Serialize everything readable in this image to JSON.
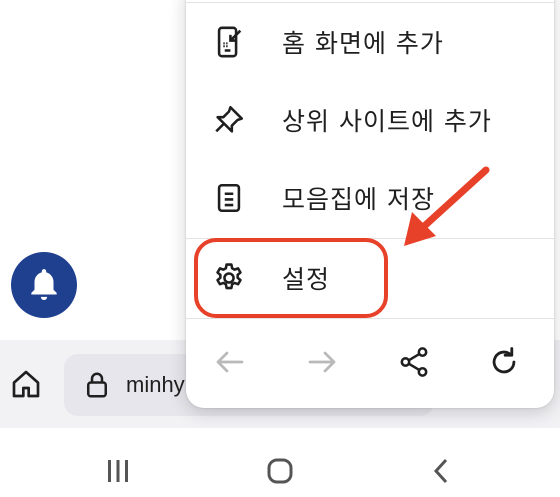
{
  "menu": {
    "items": [
      {
        "label": "홈 화면에 추가",
        "icon": "add-to-home-screen-icon"
      },
      {
        "label": "상위 사이트에 추가",
        "icon": "pin-icon"
      },
      {
        "label": "모음집에 저장",
        "icon": "collection-icon"
      },
      {
        "label": "설정",
        "icon": "gear-icon"
      }
    ],
    "tools": [
      "back-arrow-icon",
      "forward-arrow-icon",
      "share-icon",
      "reload-icon"
    ]
  },
  "url_bar": {
    "text": "minhy"
  },
  "annotation": {
    "color": "#e8412a"
  },
  "colors": {
    "bell_fab": "#1f3f8f",
    "bottom_bar": "#f2f2f5"
  }
}
